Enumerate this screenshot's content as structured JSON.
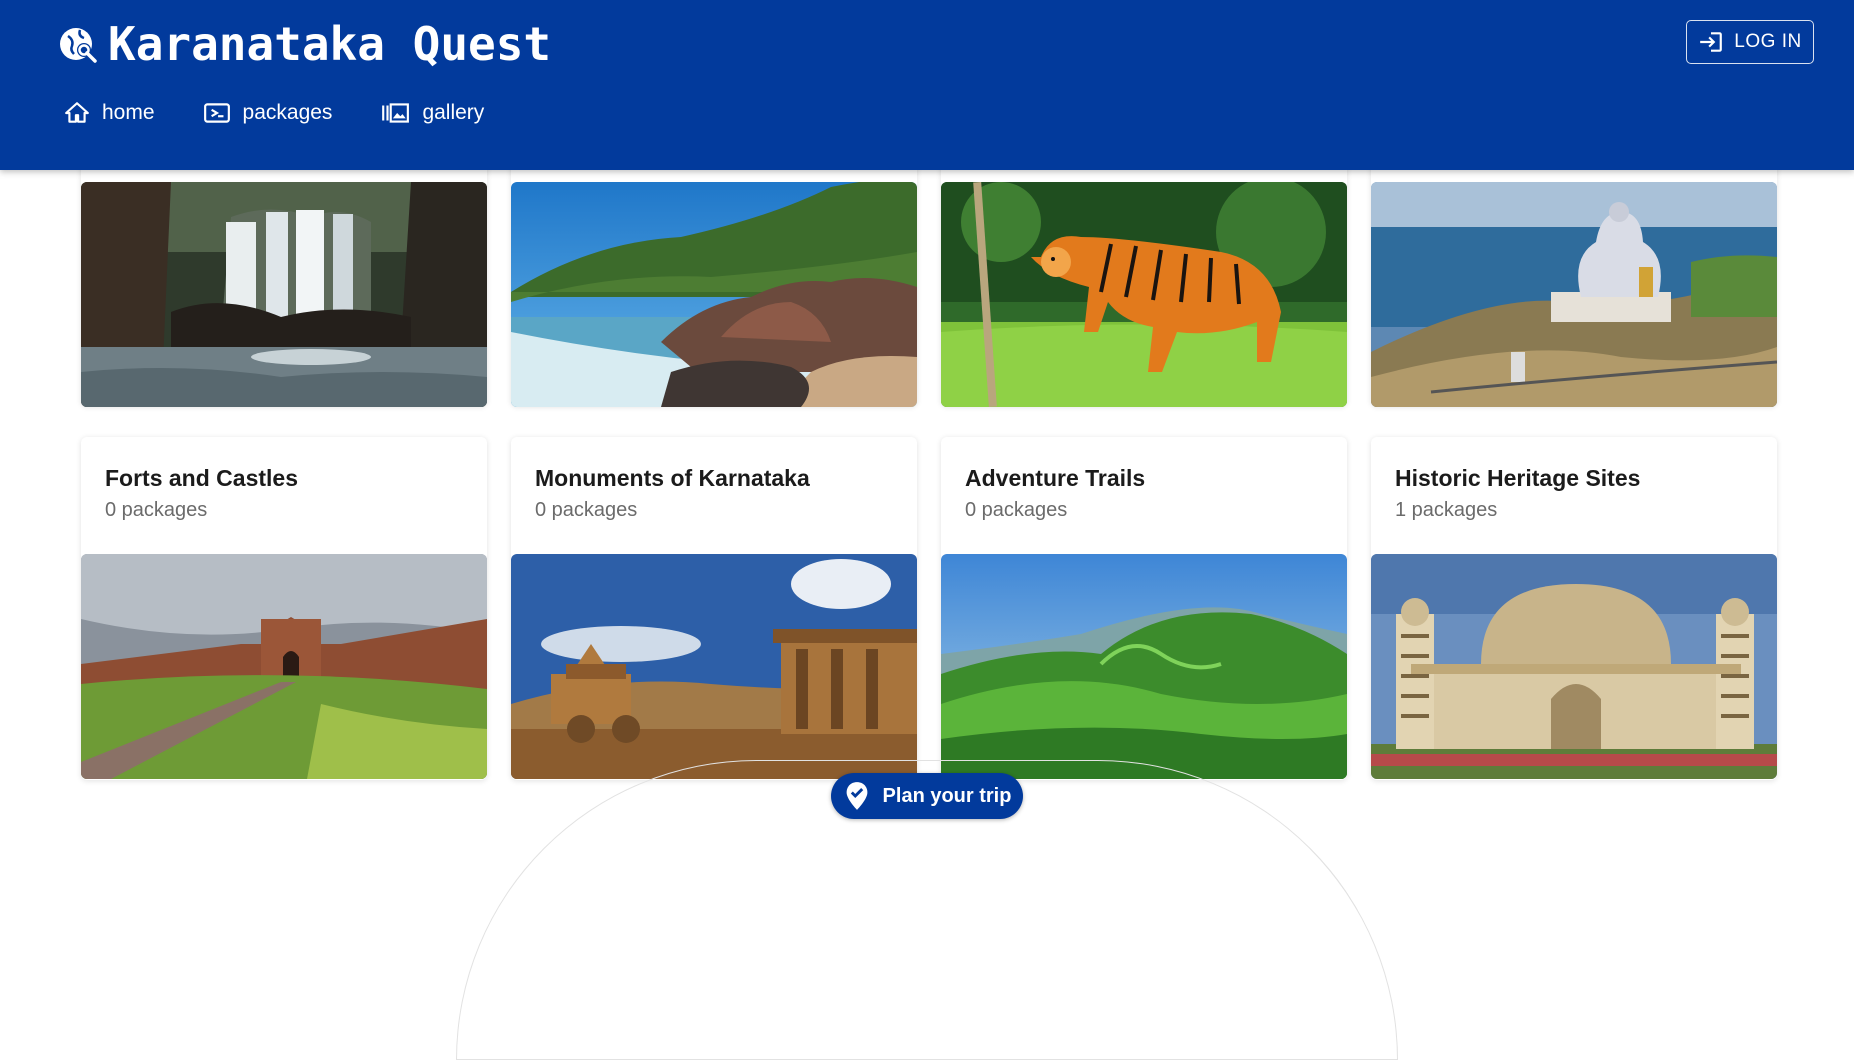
{
  "app": {
    "title": "Karanataka Quest",
    "logo_icon": "travel-explore-icon"
  },
  "header": {
    "login_label": "LOG IN",
    "nav": [
      {
        "label": "home",
        "icon": "home-icon"
      },
      {
        "label": "packages",
        "icon": "tour-ticket-icon"
      },
      {
        "label": "gallery",
        "icon": "gallery-icon"
      }
    ]
  },
  "top_row": [
    {
      "image": "waterfall"
    },
    {
      "image": "coastal-rocks"
    },
    {
      "image": "tiger"
    },
    {
      "image": "shiva-statue"
    }
  ],
  "categories": [
    {
      "title": "Forts and Castles",
      "count": "0 packages",
      "image": "fort"
    },
    {
      "title": "Monuments of Karnataka",
      "count": "0 packages",
      "image": "stone-chariot"
    },
    {
      "title": "Adventure Trails",
      "count": "0 packages",
      "image": "green-hills"
    },
    {
      "title": "Historic Heritage Sites",
      "count": "1 packages",
      "image": "gol-gumbaz"
    }
  ],
  "cta": {
    "label": "Plan your trip",
    "icon": "location-check-icon"
  },
  "colors": {
    "primary": "#023a9c",
    "text": "#1b1b1b",
    "muted": "#6b6b6b"
  }
}
